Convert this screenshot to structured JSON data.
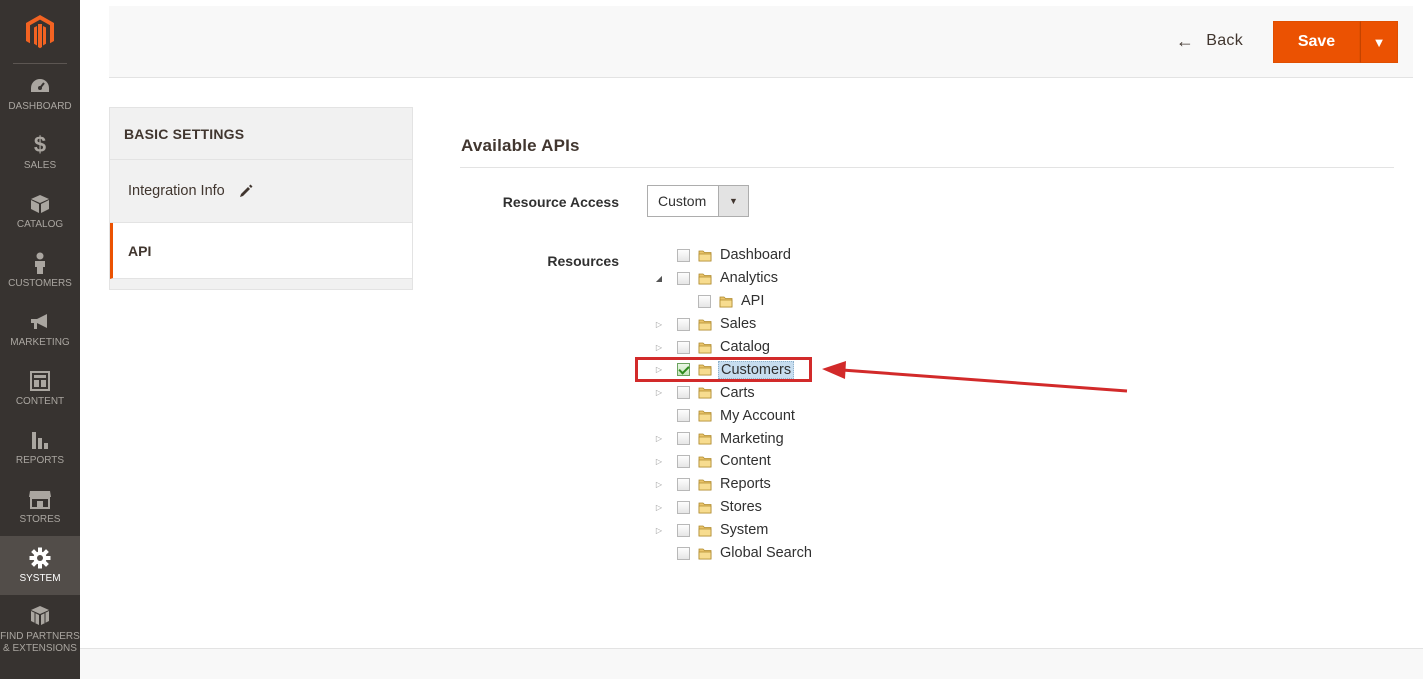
{
  "sidebar": {
    "items": [
      {
        "label": "DASHBOARD",
        "icon": "dashboard-gauge-icon",
        "active": false
      },
      {
        "label": "SALES",
        "icon": "dollar-icon",
        "active": false
      },
      {
        "label": "CATALOG",
        "icon": "cube-icon",
        "active": false
      },
      {
        "label": "CUSTOMERS",
        "icon": "person-icon",
        "active": false
      },
      {
        "label": "MARKETING",
        "icon": "megaphone-icon",
        "active": false
      },
      {
        "label": "CONTENT",
        "icon": "layout-icon",
        "active": false
      },
      {
        "label": "REPORTS",
        "icon": "bar-chart-icon",
        "active": false
      },
      {
        "label": "STORES",
        "icon": "storefront-icon",
        "active": false
      },
      {
        "label": "SYSTEM",
        "icon": "gear-icon",
        "active": true
      },
      {
        "label": "FIND PARTNERS & EXTENSIONS",
        "icon": "boxes-icon",
        "active": false
      }
    ]
  },
  "header": {
    "back_label": "Back",
    "save_label": "Save"
  },
  "tabs": {
    "title": "BASIC SETTINGS",
    "items": [
      {
        "label": "Integration Info",
        "active": false
      },
      {
        "label": "API",
        "active": true
      }
    ]
  },
  "main": {
    "section_title": "Available APIs",
    "resource_access_label": "Resource Access",
    "resource_access_value": "Custom",
    "resources_label": "Resources"
  },
  "tree": [
    {
      "label": "Dashboard",
      "toggle": "none",
      "checked": false,
      "level": 0
    },
    {
      "label": "Analytics",
      "toggle": "open",
      "checked": false,
      "level": 0
    },
    {
      "label": "API",
      "toggle": "none",
      "checked": false,
      "level": 1
    },
    {
      "label": "Sales",
      "toggle": "closed",
      "checked": false,
      "level": 0
    },
    {
      "label": "Catalog",
      "toggle": "closed",
      "checked": false,
      "level": 0
    },
    {
      "label": "Customers",
      "toggle": "closed",
      "checked": true,
      "level": 0,
      "selected": true
    },
    {
      "label": "Carts",
      "toggle": "closed",
      "checked": false,
      "level": 0
    },
    {
      "label": "My Account",
      "toggle": "none",
      "checked": false,
      "level": 0
    },
    {
      "label": "Marketing",
      "toggle": "closed",
      "checked": false,
      "level": 0
    },
    {
      "label": "Content",
      "toggle": "closed",
      "checked": false,
      "level": 0
    },
    {
      "label": "Reports",
      "toggle": "closed",
      "checked": false,
      "level": 0
    },
    {
      "label": "Stores",
      "toggle": "closed",
      "checked": false,
      "level": 0
    },
    {
      "label": "System",
      "toggle": "closed",
      "checked": false,
      "level": 0
    },
    {
      "label": "Global Search",
      "toggle": "none",
      "checked": false,
      "level": 0
    }
  ],
  "colors": {
    "sidebar_bg": "#373330",
    "accent": "#eb5202",
    "annotation": "#d22a2a"
  }
}
